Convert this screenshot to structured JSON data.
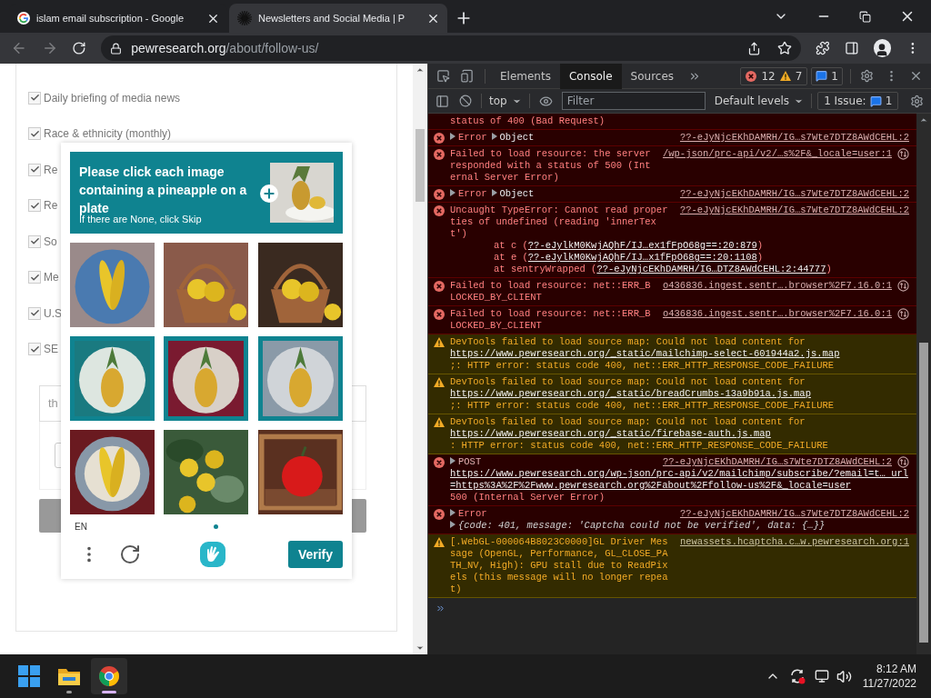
{
  "browser": {
    "tabs": [
      {
        "title": "islam email subscription - Google",
        "selected": false
      },
      {
        "title": "Newsletters and Social Media | P",
        "selected": true
      }
    ],
    "address": {
      "host": "pewresearch.org",
      "path": "/about/follow-us/"
    }
  },
  "page": {
    "checkboxes": [
      {
        "label": "Daily briefing of media news",
        "checked": true
      },
      {
        "label": "Race & ethnicity (monthly)",
        "checked": true
      },
      {
        "label": "Re",
        "checked": true
      },
      {
        "label": "Re",
        "checked": true
      },
      {
        "label": "So",
        "checked": true
      },
      {
        "label": "Me",
        "checked": true
      },
      {
        "label": "U.S",
        "checked": true
      },
      {
        "label": "SE",
        "checked": true
      }
    ],
    "field_value": "th"
  },
  "captcha": {
    "prompt": "Please click each image containing a pineapple on a plate",
    "hint": "If there are None, click Skip",
    "tiles": [
      {
        "selected": false
      },
      {
        "selected": false
      },
      {
        "selected": false
      },
      {
        "selected": true
      },
      {
        "selected": true
      },
      {
        "selected": true
      },
      {
        "selected": false
      },
      {
        "selected": false
      },
      {
        "selected": false
      }
    ],
    "language": "EN",
    "button": "Verify"
  },
  "devtools": {
    "tabs": [
      {
        "label": "Elements",
        "selected": false
      },
      {
        "label": "Console",
        "selected": true
      },
      {
        "label": "Sources",
        "selected": false
      }
    ],
    "errors": "12",
    "warnings": "7",
    "infos": "1",
    "context": "top",
    "filter_placeholder": "Filter",
    "levels": "Default levels",
    "issues_label": "1 Issue:",
    "issues_count": "1",
    "messages": [
      {
        "kind": "error",
        "icon": false,
        "network": false,
        "parts": [
          {
            "kind": "text",
            "text": "status of 400 (Bad Request)"
          }
        ]
      },
      {
        "kind": "error",
        "icon": true,
        "network": false,
        "source": "??-eJyNjcEKhDAMRH/IG…s7Wte7DTZ8AWdCEHL:2",
        "parts": [
          {
            "kind": "toggle",
            "text": "Error",
            "color": "#ff8080"
          },
          {
            "kind": "toggle",
            "text": "Object",
            "color": "#e8eaed"
          }
        ]
      },
      {
        "kind": "error",
        "icon": true,
        "network": true,
        "source": "/wp-json/prc-api/v2/…s%2F&_locale=user:1",
        "parts": [
          {
            "kind": "text",
            "text": "Failed to load resource: the server responded with a status of 500 (Internal Server Error)"
          }
        ]
      },
      {
        "kind": "error",
        "icon": true,
        "network": false,
        "source": "??-eJyNjcEKhDAMRH/IG…s7Wte7DTZ8AWdCEHL:2",
        "parts": [
          {
            "kind": "toggle",
            "text": "Error",
            "color": "#ff8080"
          },
          {
            "kind": "toggle",
            "text": "Object",
            "color": "#e8eaed"
          }
        ]
      },
      {
        "kind": "error",
        "icon": true,
        "network": false,
        "source": "??-eJyNjcEKhDAMRH/IG…s7Wte7DTZ8AWdCEHL:2",
        "parts": [
          {
            "kind": "text",
            "text": "Uncaught TypeError: Cannot read properties of undefined (reading 'innerText')"
          }
        ],
        "details": [
          {
            "kind": "trace",
            "prefix": "at c (",
            "link": "??-eJylkM0KwjAQhF/IJ…ex1fFpO68g==:20:879",
            "suffix": ")"
          },
          {
            "kind": "trace",
            "prefix": "at e (",
            "link": "??-eJylkM0KwjAQhF/IJ…x1fFpO68g==:20:1108",
            "suffix": ")"
          },
          {
            "kind": "trace",
            "prefix": "at sentryWrapped (",
            "link": "??-eJyNjcEKhDAMRH/IG…DTZ8AWdCEHL:2:44777",
            "suffix": ")"
          }
        ]
      },
      {
        "kind": "error",
        "icon": true,
        "network": true,
        "source": "o436836.ingest.sentr….browser%2F7.16.0:1",
        "parts": [
          {
            "kind": "text",
            "text": "Failed to load resource: net::ERR_BLOCKED_BY_CLIENT"
          }
        ]
      },
      {
        "kind": "error",
        "icon": true,
        "network": true,
        "source": "o436836.ingest.sentr….browser%2F7.16.0:1",
        "parts": [
          {
            "kind": "text",
            "text": "Failed to load resource: net::ERR_BLOCKED_BY_CLIENT"
          }
        ]
      },
      {
        "kind": "warning",
        "icon": true,
        "network": false,
        "parts": [
          {
            "kind": "text",
            "text": "DevTools failed to load source map: Could not load content for "
          },
          {
            "kind": "link",
            "text": "https://www.pewresearch.org/_static/mailchimp-select-601944a2.js.map"
          },
          {
            "kind": "text",
            "text": ";: HTTP error: status code 400, net::ERR_HTTP_RESPONSE_CODE_FAILURE"
          }
        ]
      },
      {
        "kind": "warning",
        "icon": true,
        "network": false,
        "parts": [
          {
            "kind": "text",
            "text": "DevTools failed to load source map: Could not load content for "
          },
          {
            "kind": "link",
            "text": "https://www.pewresearch.org/_static/breadCrumbs-13a9b91a.js.map"
          },
          {
            "kind": "text",
            "text": ";: HTTP error: status code 400, net::ERR_HTTP_RESPONSE_CODE_FAILURE"
          }
        ]
      },
      {
        "kind": "warning",
        "icon": true,
        "network": false,
        "parts": [
          {
            "kind": "text",
            "text": "DevTools failed to load source map: Could not load content for "
          },
          {
            "kind": "link",
            "text": "https://www.pewresearch.org/_static/firebase-auth.js.map"
          },
          {
            "kind": "text",
            "text": ": HTTP error: status code 400, net::ERR_HTTP_RESPONSE_CODE_FAILURE"
          }
        ]
      },
      {
        "kind": "error",
        "icon": true,
        "network": true,
        "source": "??-eJyNjcEKhDAMRH/IG…s7Wte7DTZ8AWdCEHL:2",
        "parts": [
          {
            "kind": "toggle",
            "text": "POST",
            "color": "#e0b0b0"
          }
        ],
        "details": [
          {
            "kind": "text",
            "parts": [
              {
                "kind": "link",
                "text": "https://www.pewresearch.org/wp-json/prc-api/v2/mailchimp/subscribe/?email=t… url=https%3A%2F%2Fwww.pewresearch.org%2Fabout%2Ffollow-us%2F&_locale=user"
              },
              {
                "kind": "text",
                "text": " 500 (Internal Server Error)"
              }
            ]
          }
        ]
      },
      {
        "kind": "error",
        "icon": true,
        "network": false,
        "source": "??-eJyNjcEKhDAMRH/IG…s7Wte7DTZ8AWdCEHL:2",
        "parts": [
          {
            "kind": "toggle",
            "text": "Error",
            "color": "#ff8080"
          }
        ],
        "details": [
          {
            "kind": "object",
            "text": "{code: 401, message: 'Captcha could not be verified', data: {…}}"
          }
        ]
      },
      {
        "kind": "warning",
        "icon": true,
        "network": false,
        "source": "newassets.hcaptcha.c…w.pewresearch.org:1",
        "parts": [
          {
            "kind": "text",
            "text": "[.WebGL-000064B8023C0000]GL Driver Message (OpenGL, Performance, GL_CLOSE_PATH_NV, High): GPU stall due to ReadPixels (this message will no longer repeat)"
          }
        ]
      }
    ]
  },
  "taskbar": {
    "apps": [
      {
        "kind": "start",
        "selected": false
      },
      {
        "kind": "explorer",
        "selected": false
      },
      {
        "kind": "chrome",
        "selected": true
      }
    ],
    "time": "8:12 AM",
    "date": "11/27/2022"
  }
}
